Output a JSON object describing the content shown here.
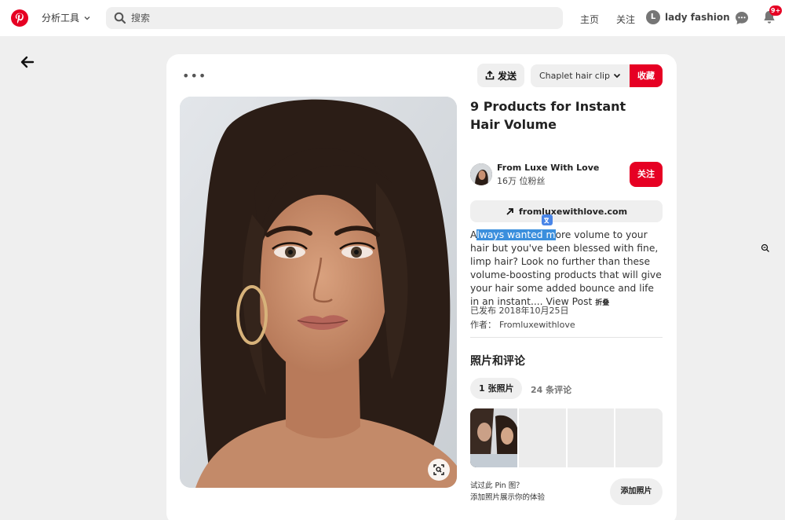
{
  "colors": {
    "brand": "#e60023",
    "surface": "#efefef",
    "selection": "#3b8fdd"
  },
  "nav": {
    "logo_icon": "pinterest-logo-icon",
    "analytics_label": "分析工具",
    "search_placeholder": "搜索",
    "home_label": "主页",
    "following_label": "关注",
    "avatar_initial": "L",
    "account_name": "lady fashion",
    "notification_count": "9+"
  },
  "pin": {
    "more_icon": "•••",
    "send_label": "发送",
    "board_name": "Chaplet hair clip",
    "save_label": "收藏",
    "title": "9 Products for Instant Hair Volume",
    "creator": {
      "name": "From Luxe With Love",
      "followers": "16万 位粉丝",
      "follow_label": "关注"
    },
    "source_link": "fromluxewithlove.com",
    "description": {
      "before_highlight": "A",
      "highlight": "lways wanted m",
      "after_highlight": "ore volume to your hair but you've been blessed with fine, limp hair? Look no further than these volume-boosting products that will give your hair some added bounce and life in an instant.... ",
      "view_post": "View Post",
      "fold": "折叠"
    },
    "published": "已发布 2018年10月25日",
    "author_label": "作者：",
    "author_name": "Fromluxewithlove"
  },
  "photos_section": {
    "title": "照片和评论",
    "tab_photos": "1 张照片",
    "tab_comments": "24 条评论",
    "prompt_line1": "试过此 Pin 图？",
    "prompt_line2": "添加照片展示你的体验",
    "add_photo_label": "添加照片"
  }
}
